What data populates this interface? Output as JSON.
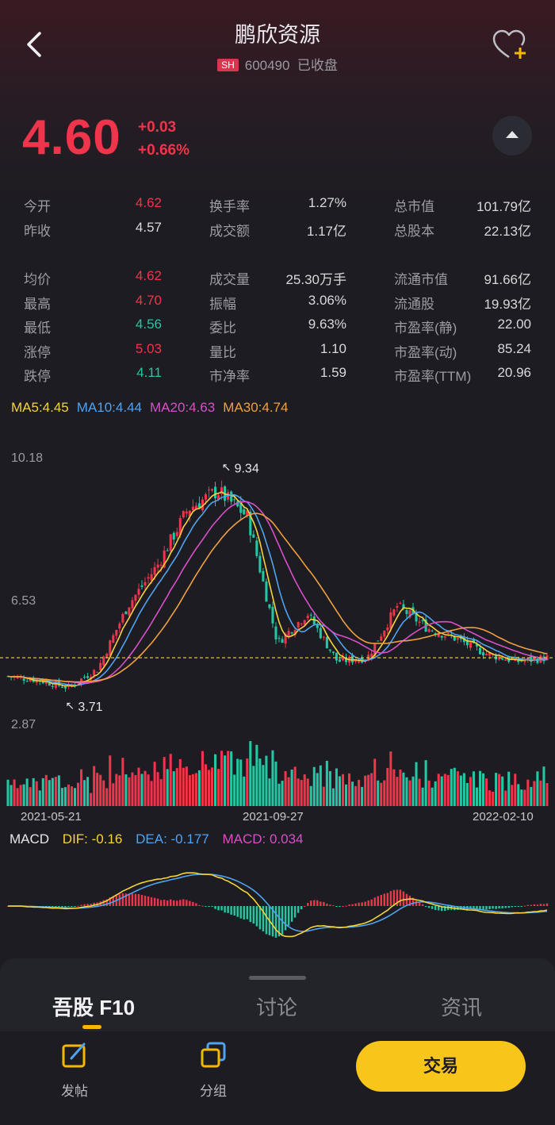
{
  "header": {
    "title": "鹏欣资源",
    "exchange": "SH",
    "code": "600490",
    "status": "已收盘"
  },
  "quote": {
    "price": "4.60",
    "change": "+0.03",
    "change_pct": "+0.66%"
  },
  "stats": [
    [
      {
        "label": "今开",
        "value": "4.62",
        "color": "red"
      },
      {
        "label": "昨收",
        "value": "4.57",
        "color": "white"
      },
      {
        "label": "均价",
        "value": "4.62",
        "color": "red"
      },
      {
        "label": "最高",
        "value": "4.70",
        "color": "red"
      },
      {
        "label": "最低",
        "value": "4.56",
        "color": "green"
      },
      {
        "label": "涨停",
        "value": "5.03",
        "color": "red"
      },
      {
        "label": "跌停",
        "value": "4.11",
        "color": "green"
      }
    ],
    [
      {
        "label": "换手率",
        "value": "1.27%",
        "color": "white"
      },
      {
        "label": "成交额",
        "value": "1.17亿",
        "color": "white"
      },
      {
        "label": "成交量",
        "value": "25.30万手",
        "color": "white"
      },
      {
        "label": "振幅",
        "value": "3.06%",
        "color": "white"
      },
      {
        "label": "委比",
        "value": "9.63%",
        "color": "white"
      },
      {
        "label": "量比",
        "value": "1.10",
        "color": "white"
      },
      {
        "label": "市净率",
        "value": "1.59",
        "color": "white"
      }
    ],
    [
      {
        "label": "总市值",
        "value": "101.79亿",
        "color": "white"
      },
      {
        "label": "总股本",
        "value": "22.13亿",
        "color": "white"
      },
      {
        "label": "流通市值",
        "value": "91.66亿",
        "color": "white"
      },
      {
        "label": "流通股",
        "value": "19.93亿",
        "color": "white"
      },
      {
        "label": "市盈率(静)",
        "value": "22.00",
        "color": "white"
      },
      {
        "label": "市盈率(动)",
        "value": "85.24",
        "color": "white"
      },
      {
        "label": "市盈率(TTM)",
        "value": "20.96",
        "color": "white"
      }
    ]
  ],
  "ma_legend": [
    {
      "text": "MA5:4.45",
      "color": "#f5d33a"
    },
    {
      "text": "MA10:4.44",
      "color": "#4fa3f0"
    },
    {
      "text": "MA20:4.63",
      "color": "#d84fc8"
    },
    {
      "text": "MA30:4.74",
      "color": "#f0a040"
    }
  ],
  "chart_data": [
    {
      "type": "candlestick",
      "title": "",
      "y_axis_labels": [
        "10.18",
        "6.53",
        "2.87"
      ],
      "ylim": [
        2.87,
        10.18
      ],
      "annotations": [
        {
          "text": "9.34",
          "date": "2021-09",
          "value": 9.34
        },
        {
          "text": "3.71",
          "date": "2021-06",
          "value": 3.71
        }
      ],
      "current_price_line": 4.6,
      "close_trend": {
        "x": [
          "2021-04",
          "2021-05-21",
          "2021-06",
          "2021-07",
          "2021-08-01",
          "2021-08-20",
          "2021-09-10",
          "2021-09-20",
          "2021-09-27",
          "2021-10-10",
          "2021-10-25",
          "2021-11-10",
          "2021-11-25",
          "2021-12-10",
          "2021-12-25",
          "2022-01-10",
          "2022-01-25",
          "2022-02-10",
          "2022-02-20"
        ],
        "values": [
          4.1,
          4.0,
          3.8,
          4.3,
          6.0,
          7.1,
          8.6,
          9.1,
          8.4,
          5.0,
          5.8,
          4.5,
          4.6,
          6.0,
          5.4,
          5.1,
          4.7,
          4.5,
          4.6
        ]
      },
      "moving_averages": [
        {
          "name": "MA5",
          "last": 4.45,
          "color": "#f5d33a"
        },
        {
          "name": "MA10",
          "last": 4.44,
          "color": "#4fa3f0"
        },
        {
          "name": "MA20",
          "last": 4.63,
          "color": "#d84fc8"
        },
        {
          "name": "MA30",
          "last": 4.74,
          "color": "#f0a040"
        }
      ]
    },
    {
      "type": "bar",
      "title": "",
      "series_name": "",
      "x_tick_labels": [
        "2021-05-21",
        "2021-09-27",
        "2022-02-10"
      ],
      "colors": {
        "up": "#f0344c",
        "down": "#25c6a3"
      }
    },
    {
      "type": "line",
      "title": "MACD",
      "legend": [
        {
          "text": "DIF: -0.16",
          "color": "#f5d33a"
        },
        {
          "text": "DEA: -0.177",
          "color": "#4fa3f0"
        },
        {
          "text": "MACD: 0.034",
          "color": "#d84fc8"
        }
      ]
    }
  ],
  "tabs": [
    {
      "label": "吾股 F10",
      "active": true
    },
    {
      "label": "讨论",
      "active": false
    },
    {
      "label": "资讯",
      "active": false
    }
  ],
  "bottom_bar": {
    "post": "发帖",
    "group": "分组",
    "trade": "交易"
  },
  "colors": {
    "up": "#f0344c",
    "down": "#25c6a3",
    "accent": "#f8c61a",
    "background": "#1c1c22"
  }
}
